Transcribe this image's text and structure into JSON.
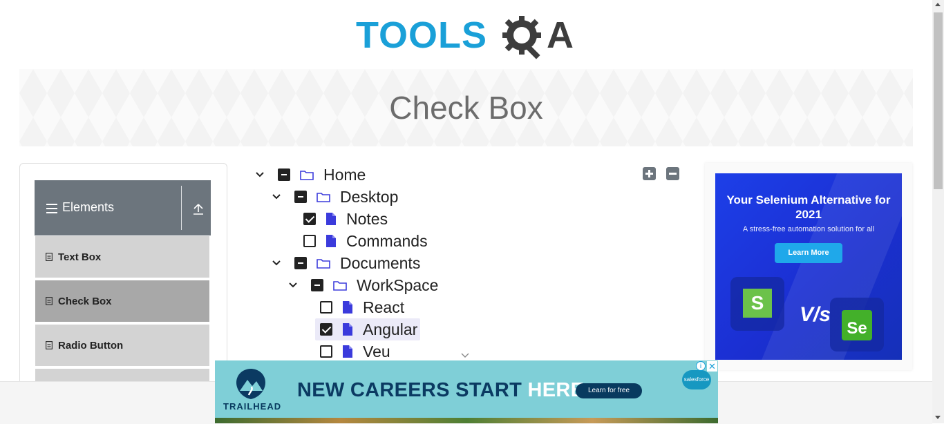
{
  "header": {
    "logo_tools": "TOOLS",
    "logo_qa": "A"
  },
  "banner": {
    "title": "Check Box"
  },
  "sidebar": {
    "group_title": "Elements",
    "items": [
      {
        "label": "Text Box",
        "active": false
      },
      {
        "label": "Check Box",
        "active": true
      },
      {
        "label": "Radio Button",
        "active": false
      }
    ]
  },
  "tree": {
    "nodes": [
      {
        "label": "Home",
        "state": "partial",
        "type": "folder",
        "expanded": true,
        "level": 0
      },
      {
        "label": "Desktop",
        "state": "partial",
        "type": "folder",
        "expanded": true,
        "level": 1
      },
      {
        "label": "Notes",
        "state": "checked",
        "type": "file",
        "level": 2
      },
      {
        "label": "Commands",
        "state": "unchecked",
        "type": "file",
        "level": 2
      },
      {
        "label": "Documents",
        "state": "partial",
        "type": "folder",
        "expanded": true,
        "level": 1
      },
      {
        "label": "WorkSpace",
        "state": "partial",
        "type": "folder",
        "expanded": true,
        "level": 2
      },
      {
        "label": "React",
        "state": "unchecked",
        "type": "file",
        "level": 3
      },
      {
        "label": "Angular",
        "state": "checked",
        "type": "file",
        "level": 3,
        "highlighted": true
      },
      {
        "label": "Veu",
        "state": "unchecked",
        "type": "file",
        "level": 3
      }
    ]
  },
  "ad_right": {
    "headline": "Your Selenium Alternative for 2021",
    "subtext": "A stress-free automation solution for all",
    "button": "Learn More",
    "vs": "V/s",
    "logo_left": "S",
    "logo_right": "Se"
  },
  "ad_bottom": {
    "brand": "TRAILHEAD",
    "headline_main": "NEW CAREERS START ",
    "headline_accent": "HERE.",
    "cta": "Learn for free",
    "partner": "salesforce",
    "info": "i",
    "close": "✕"
  },
  "colors": {
    "accent_blue": "#1aa0d8",
    "sidebar_header": "#6c757d",
    "ad_blue": "#1d3fe8",
    "trail_bg": "#7fcfd7"
  }
}
